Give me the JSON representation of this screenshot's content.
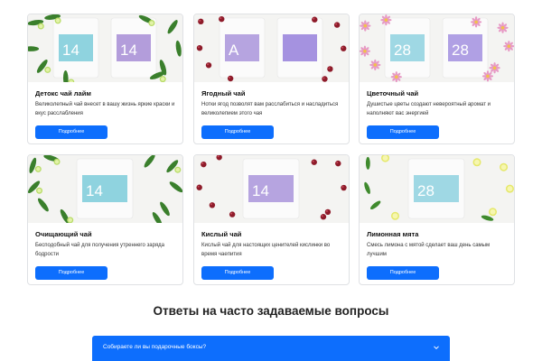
{
  "products": [
    {
      "title": "Детокс чай лайм",
      "text": "Великолепный чай внесет в вашу жизнь яркие краски и вкус расслабления",
      "button": "Подробнее",
      "labels": [
        "14",
        "14"
      ],
      "label_colors": [
        "#8fd3df",
        "#b39ddb"
      ],
      "decor": "lime-leaves",
      "image_icon": "tea-pack-lime-image"
    },
    {
      "title": "Ягодный чай",
      "text": "Нотки ягод позволят вам расслабиться и насладиться великолепием этого чая",
      "button": "Подробнее",
      "labels": [
        "A",
        ""
      ],
      "label_colors": [
        "#b6a4e0",
        "#a592e0"
      ],
      "decor": "berries",
      "image_icon": "tea-pack-berry-image"
    },
    {
      "title": "Цветочный чай",
      "text": "Душистые цветы создают невероятный аромат и наполняют вас энергией",
      "button": "Подробнее",
      "labels": [
        "28",
        "28"
      ],
      "label_colors": [
        "#9fd8e4",
        "#b0a0e4"
      ],
      "decor": "flowers",
      "image_icon": "tea-pack-flower-image"
    },
    {
      "title": "Очищающий чай",
      "text": "Бесподобный чай для получения утреннего заряда бодрости",
      "button": "Подробнее",
      "labels": [
        "14"
      ],
      "label_colors": [
        "#8fd3df"
      ],
      "decor": "lime-leaves",
      "image_icon": "tea-pack-cleansing-image"
    },
    {
      "title": "Кислый чай",
      "text": "Кислый чай для настоящих ценителей кислинки во время чаепития",
      "button": "Подробнее",
      "labels": [
        "14"
      ],
      "label_colors": [
        "#b6a4e0"
      ],
      "decor": "berries",
      "image_icon": "tea-pack-sour-image"
    },
    {
      "title": "Лимонная мята",
      "text": "Смесь лимона с мятой сделает ваш день самым лучшим",
      "button": "Подробнее",
      "labels": [
        "28"
      ],
      "label_colors": [
        "#9fd8e4"
      ],
      "decor": "lemon-mint",
      "image_icon": "tea-pack-lemon-mint-image"
    }
  ],
  "faq": {
    "title": "Ответы на часто задаваемые вопросы",
    "question": "Собираете ли вы подарочные боксы?",
    "chevron_icon": "chevron-down-icon"
  },
  "colors": {
    "primary": "#0d6efd",
    "card_border": "#dfe1e4"
  }
}
